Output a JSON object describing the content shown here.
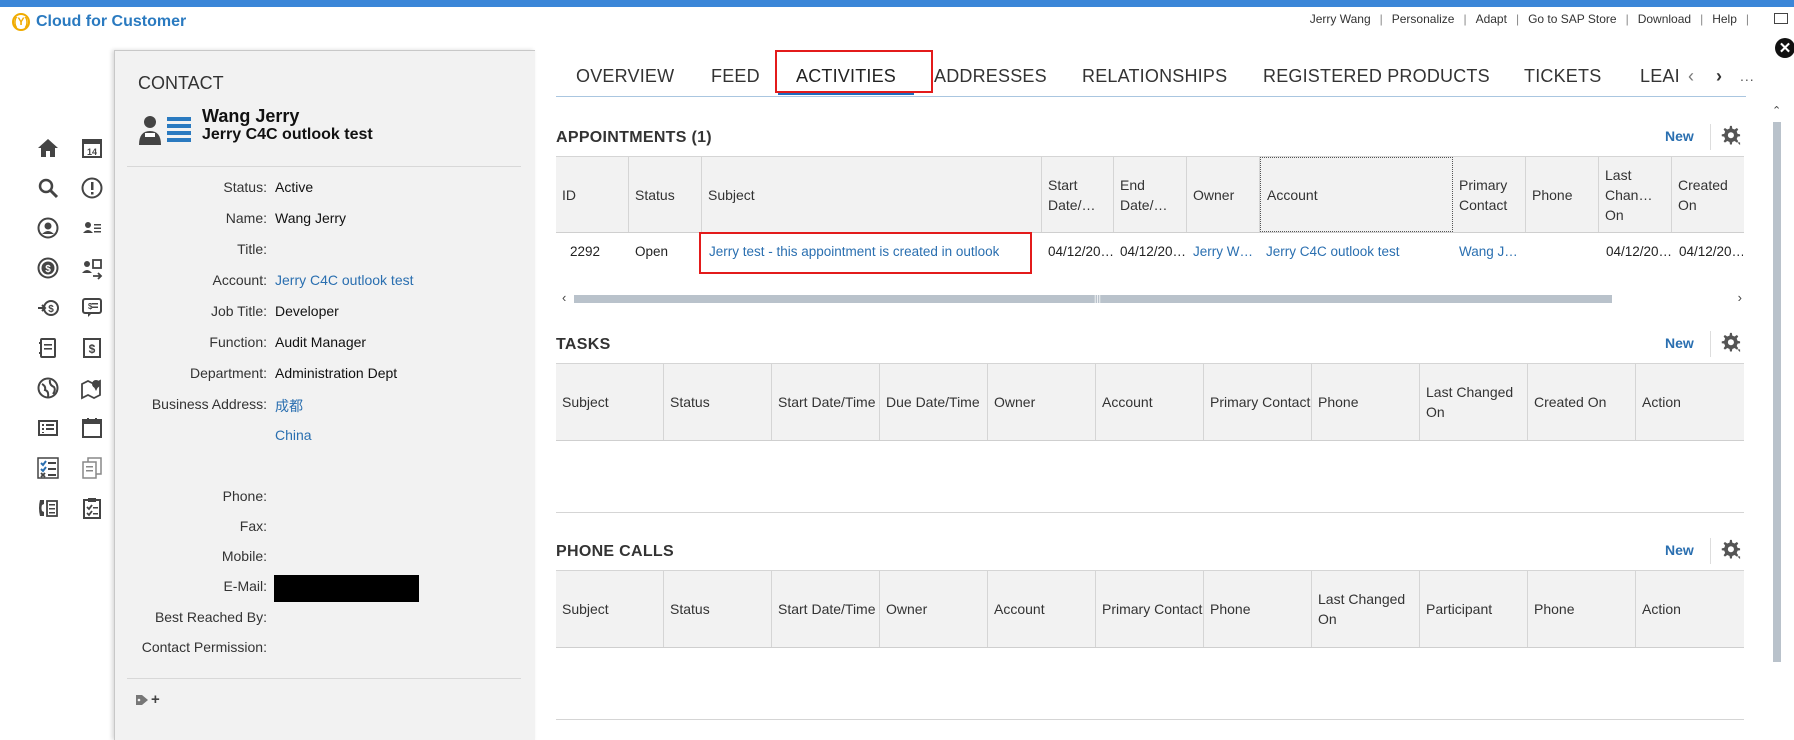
{
  "app": {
    "name": "Cloud for Customer",
    "logo_text": "(Y)"
  },
  "top_links": [
    "Jerry Wang",
    "Personalize",
    "Adapt",
    "Go to SAP Store",
    "Download",
    "Help"
  ],
  "contact": {
    "type_label": "CONTACT",
    "name": "Wang Jerry",
    "account_name": "Jerry C4C outlook test",
    "fields": [
      {
        "label": "Status:",
        "value": "Active",
        "link": false
      },
      {
        "label": "Name:",
        "value": "Wang Jerry",
        "link": false
      },
      {
        "label": "Title:",
        "value": "",
        "link": false
      },
      {
        "label": "Account:",
        "value": "Jerry C4C outlook test",
        "link": true
      },
      {
        "label": "Job Title:",
        "value": "Developer",
        "link": false
      },
      {
        "label": "Function:",
        "value": "Audit Manager",
        "link": false
      },
      {
        "label": "Department:",
        "value": "Administration Dept",
        "link": false
      },
      {
        "label": "Business Address:",
        "value": "成都",
        "link": true
      },
      {
        "label": "",
        "value": "China",
        "link": true
      },
      {
        "label": "Phone:",
        "value": "",
        "link": false
      },
      {
        "label": "Fax:",
        "value": "",
        "link": false
      },
      {
        "label": "Mobile:",
        "value": "",
        "link": false
      },
      {
        "label": "E-Mail:",
        "value": "",
        "link": false
      },
      {
        "label": "Best Reached By:",
        "value": "",
        "link": false
      },
      {
        "label": "Contact Permission:",
        "value": "",
        "link": false
      }
    ],
    "tag_add": "+"
  },
  "tabs": [
    "OVERVIEW",
    "FEED",
    "ACTIVITIES",
    "ADDRESSES",
    "RELATIONSHIPS",
    "REGISTERED PRODUCTS",
    "TICKETS",
    "LEAI"
  ],
  "active_tab": "ACTIVITIES",
  "new_label": "New",
  "appointments": {
    "title": "APPOINTMENTS (1)",
    "columns": [
      "ID",
      "Status",
      "Subject",
      "Start Date/…",
      "End Date/…",
      "Owner",
      "Account",
      "Primary Contact",
      "Phone",
      "Last Chan… On",
      "Created On"
    ],
    "row": {
      "id": "2292",
      "status": "Open",
      "subject": "Jerry test - this appointment is created in outlook",
      "start": "04/12/20…",
      "end": "04/12/20…",
      "owner": "Jerry W…",
      "account": "Jerry C4C outlook test",
      "primary_contact": "Wang J…",
      "phone": "",
      "last_changed": "04/12/20…",
      "created": "04/12/20…"
    }
  },
  "tasks": {
    "title": "TASKS",
    "columns": [
      "Subject",
      "Status",
      "Start Date/Time",
      "Due Date/Time",
      "Owner",
      "Account",
      "Primary Contact",
      "Phone",
      "Last Changed On",
      "Created On",
      "Action"
    ]
  },
  "phone_calls": {
    "title": "PHONE CALLS",
    "columns": [
      "Subject",
      "Status",
      "Start Date/Time",
      "Owner",
      "Account",
      "Primary Contact",
      "Phone",
      "Last Changed On",
      "Participant",
      "Phone",
      "Action"
    ]
  },
  "colors": {
    "accent": "#1f6cbf",
    "link": "#2a6fb0",
    "highlight": "#e31b1b",
    "topbar": "#3b86d8"
  }
}
